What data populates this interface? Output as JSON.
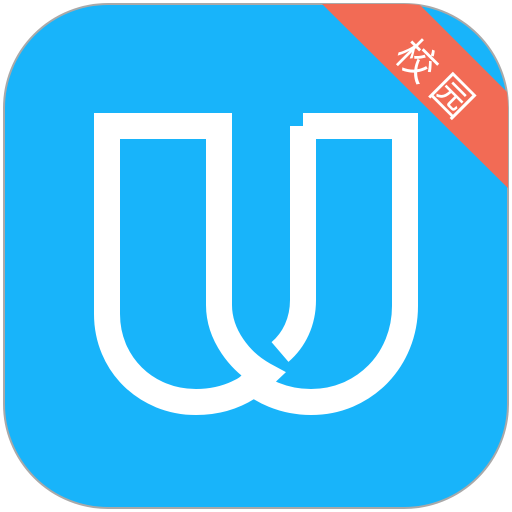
{
  "icon": {
    "background_color": "#18B4FA",
    "border_color": "#A9A9A9",
    "logo_color": "#FFFFFF",
    "logo_icon": "double-u-logo-icon"
  },
  "badge": {
    "label": "校园",
    "color": "#F26B55",
    "text_color": "#FFFFFF"
  }
}
